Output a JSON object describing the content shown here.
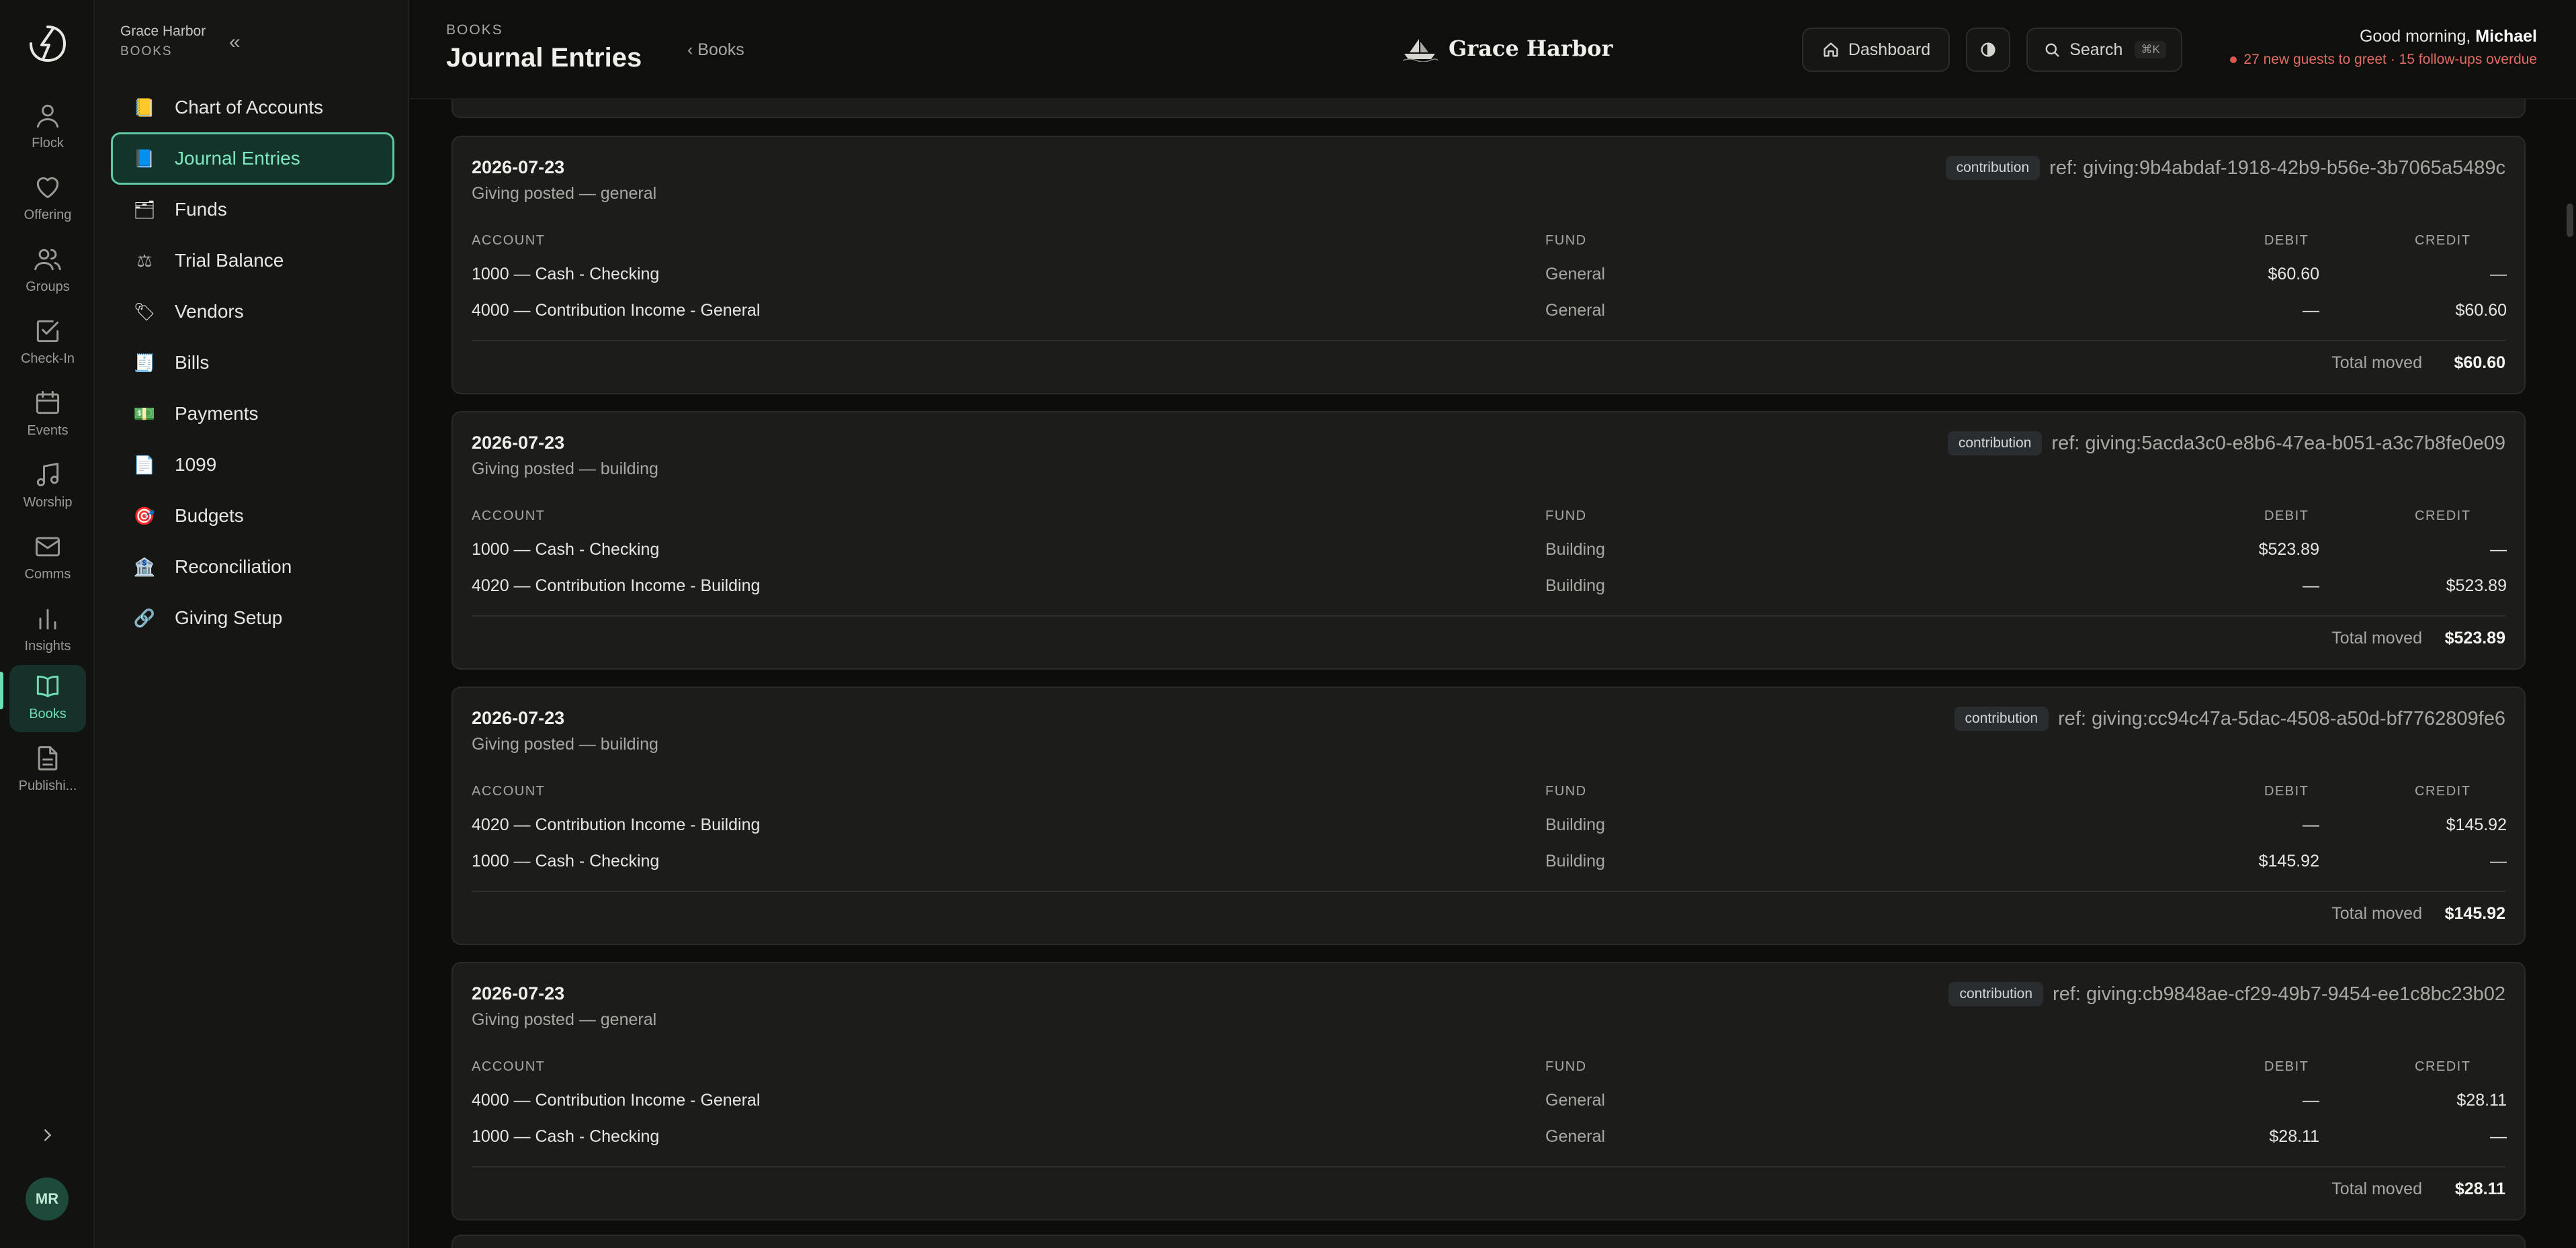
{
  "rail": {
    "items": [
      {
        "label": "Flock",
        "icon": "person-icon"
      },
      {
        "label": "Offering",
        "icon": "heart-icon"
      },
      {
        "label": "Groups",
        "icon": "people-icon"
      },
      {
        "label": "Check-In",
        "icon": "checkbox-icon"
      },
      {
        "label": "Events",
        "icon": "calendar-icon"
      },
      {
        "label": "Worship",
        "icon": "music-icon"
      },
      {
        "label": "Comms",
        "icon": "mail-icon"
      },
      {
        "label": "Insights",
        "icon": "bar-chart-icon"
      },
      {
        "label": "Books",
        "icon": "book-icon",
        "active": true
      },
      {
        "label": "Publishi...",
        "icon": "document-icon"
      }
    ],
    "avatar_initials": "MR",
    "accent": "#6fdcb3"
  },
  "sidebar": {
    "org_name": "Grace Harbor",
    "section": "BOOKS",
    "collapse": "«",
    "items": [
      {
        "label": "Chart of Accounts",
        "icon": "ledger-icon",
        "glyph": "📒"
      },
      {
        "label": "Journal Entries",
        "icon": "journal-icon",
        "glyph": "📘",
        "active": true
      },
      {
        "label": "Funds",
        "icon": "fund-folder-icon",
        "glyph": "🗂"
      },
      {
        "label": "Trial Balance",
        "icon": "scale-icon",
        "glyph": "⚖"
      },
      {
        "label": "Vendors",
        "icon": "tag-icon",
        "glyph": "🏷"
      },
      {
        "label": "Bills",
        "icon": "receipt-icon",
        "glyph": "🧾"
      },
      {
        "label": "Payments",
        "icon": "money-icon",
        "glyph": "💵"
      },
      {
        "label": "1099",
        "icon": "form-icon",
        "glyph": "📄"
      },
      {
        "label": "Budgets",
        "icon": "target-icon",
        "glyph": "🎯"
      },
      {
        "label": "Reconciliation",
        "icon": "bank-icon",
        "glyph": "🏦"
      },
      {
        "label": "Giving Setup",
        "icon": "link-icon",
        "glyph": "🔗"
      }
    ]
  },
  "header": {
    "kicker": "BOOKS",
    "title": "Journal Entries",
    "back_label": "‹ Books",
    "brand": "Grace Harbor",
    "dashboard_label": "Dashboard",
    "search_label": "Search",
    "search_shortcut": "⌘K",
    "greeting_prefix": "Good morning,",
    "greeting_name": "Michael",
    "alert": "27 new guests to greet · 15 follow-ups overdue"
  },
  "table_headers": {
    "account": "ACCOUNT",
    "fund": "FUND",
    "debit": "DEBIT",
    "credit": "CREDIT"
  },
  "total_label": "Total moved",
  "entries": [
    {
      "date": "2026-07-23",
      "description": "Giving posted — general",
      "badge": "contribution",
      "ref": "ref: giving:9b4abdaf-1918-42b9-b56e-3b7065a5489c",
      "lines": [
        {
          "account": "1000 — Cash - Checking",
          "fund": "General",
          "debit": "$60.60",
          "credit": "—"
        },
        {
          "account": "4000 — Contribution Income - General",
          "fund": "General",
          "debit": "—",
          "credit": "$60.60"
        }
      ],
      "total": "$60.60"
    },
    {
      "date": "2026-07-23",
      "description": "Giving posted — building",
      "badge": "contribution",
      "ref": "ref: giving:5acda3c0-e8b6-47ea-b051-a3c7b8fe0e09",
      "lines": [
        {
          "account": "1000 — Cash - Checking",
          "fund": "Building",
          "debit": "$523.89",
          "credit": "—"
        },
        {
          "account": "4020 — Contribution Income - Building",
          "fund": "Building",
          "debit": "—",
          "credit": "$523.89"
        }
      ],
      "total": "$523.89"
    },
    {
      "date": "2026-07-23",
      "description": "Giving posted — building",
      "badge": "contribution",
      "ref": "ref: giving:cc94c47a-5dac-4508-a50d-bf7762809fe6",
      "lines": [
        {
          "account": "4020 — Contribution Income - Building",
          "fund": "Building",
          "debit": "—",
          "credit": "$145.92"
        },
        {
          "account": "1000 — Cash - Checking",
          "fund": "Building",
          "debit": "$145.92",
          "credit": "—"
        }
      ],
      "total": "$145.92"
    },
    {
      "date": "2026-07-23",
      "description": "Giving posted — general",
      "badge": "contribution",
      "ref": "ref: giving:cb9848ae-cf29-49b7-9454-ee1c8bc23b02",
      "lines": [
        {
          "account": "4000 — Contribution Income - General",
          "fund": "General",
          "debit": "—",
          "credit": "$28.11"
        },
        {
          "account": "1000 — Cash - Checking",
          "fund": "General",
          "debit": "$28.11",
          "credit": "—"
        }
      ],
      "total": "$28.11"
    }
  ]
}
